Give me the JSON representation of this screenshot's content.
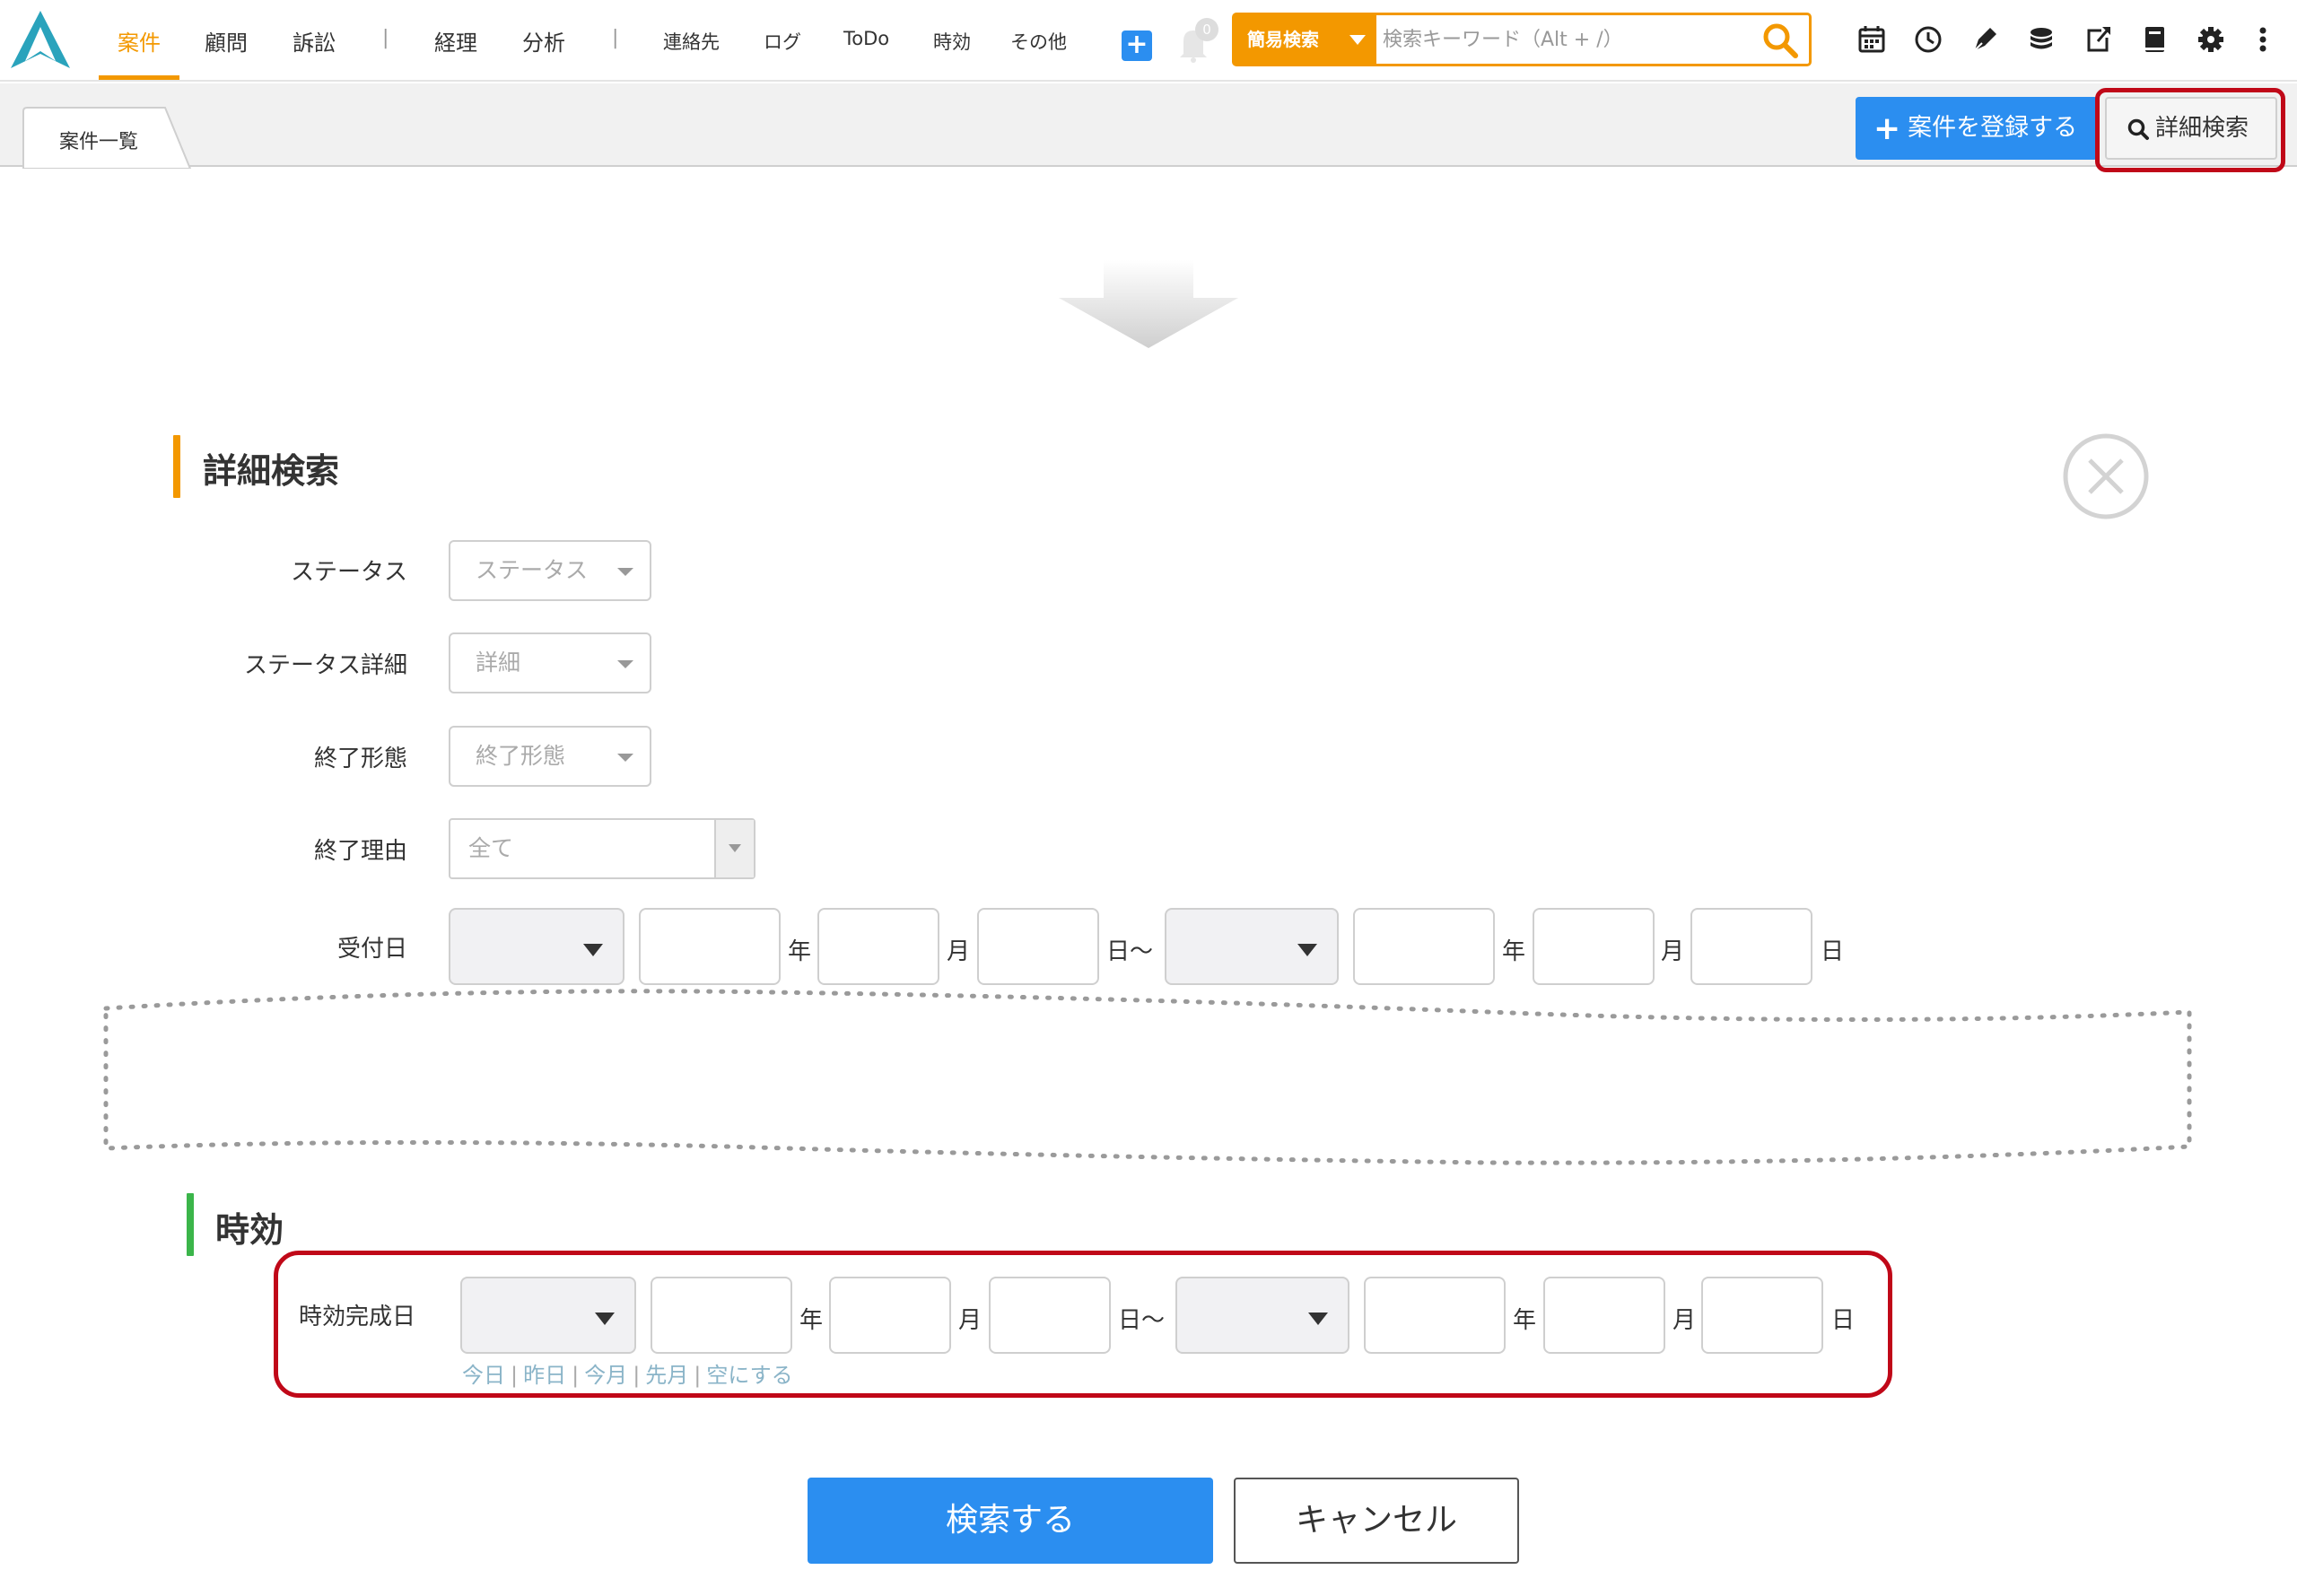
{
  "nav": {
    "items": [
      {
        "label": "案件",
        "active": true
      },
      {
        "label": "顧問"
      },
      {
        "label": "訴訟"
      },
      {
        "label": "経理"
      },
      {
        "label": "分析"
      },
      {
        "label": "連絡先"
      },
      {
        "label": "ログ"
      },
      {
        "label": "ToDo"
      },
      {
        "label": "時効"
      },
      {
        "label": "その他"
      }
    ],
    "separator": "|",
    "plus": "+",
    "bell_count": "0"
  },
  "search": {
    "mode_label": "簡易検索",
    "placeholder": "検索キーワード（Alt + /）"
  },
  "subbar": {
    "tab_label": "案件一覧",
    "register_label": "案件を登録する",
    "register_plus": "+",
    "detail_search_label": "詳細検索"
  },
  "detail_form": {
    "title": "詳細検索",
    "status": {
      "label": "ステータス",
      "value": "ステータス"
    },
    "status_detail": {
      "label": "ステータス詳細",
      "value": "詳細"
    },
    "end_type": {
      "label": "終了形態",
      "value": "終了形態"
    },
    "end_reason": {
      "label": "終了理由",
      "value": "全て"
    },
    "received_date": {
      "label": "受付日"
    },
    "units": {
      "year": "年",
      "month": "月",
      "day": "日",
      "day_range": "日〜"
    }
  },
  "limitation": {
    "title": "時効",
    "completion_date": {
      "label": "時効完成日"
    },
    "quick_links": [
      "今日",
      "昨日",
      "今月",
      "先月",
      "空にする"
    ],
    "quick_sep": "|"
  },
  "actions": {
    "search_label": "検索する",
    "cancel_label": "キャンセル"
  },
  "colors": {
    "accent_orange": "#f39800",
    "primary_blue": "#2b8ef0",
    "highlight_red": "#c00818",
    "section_green": "#3bb54a"
  }
}
